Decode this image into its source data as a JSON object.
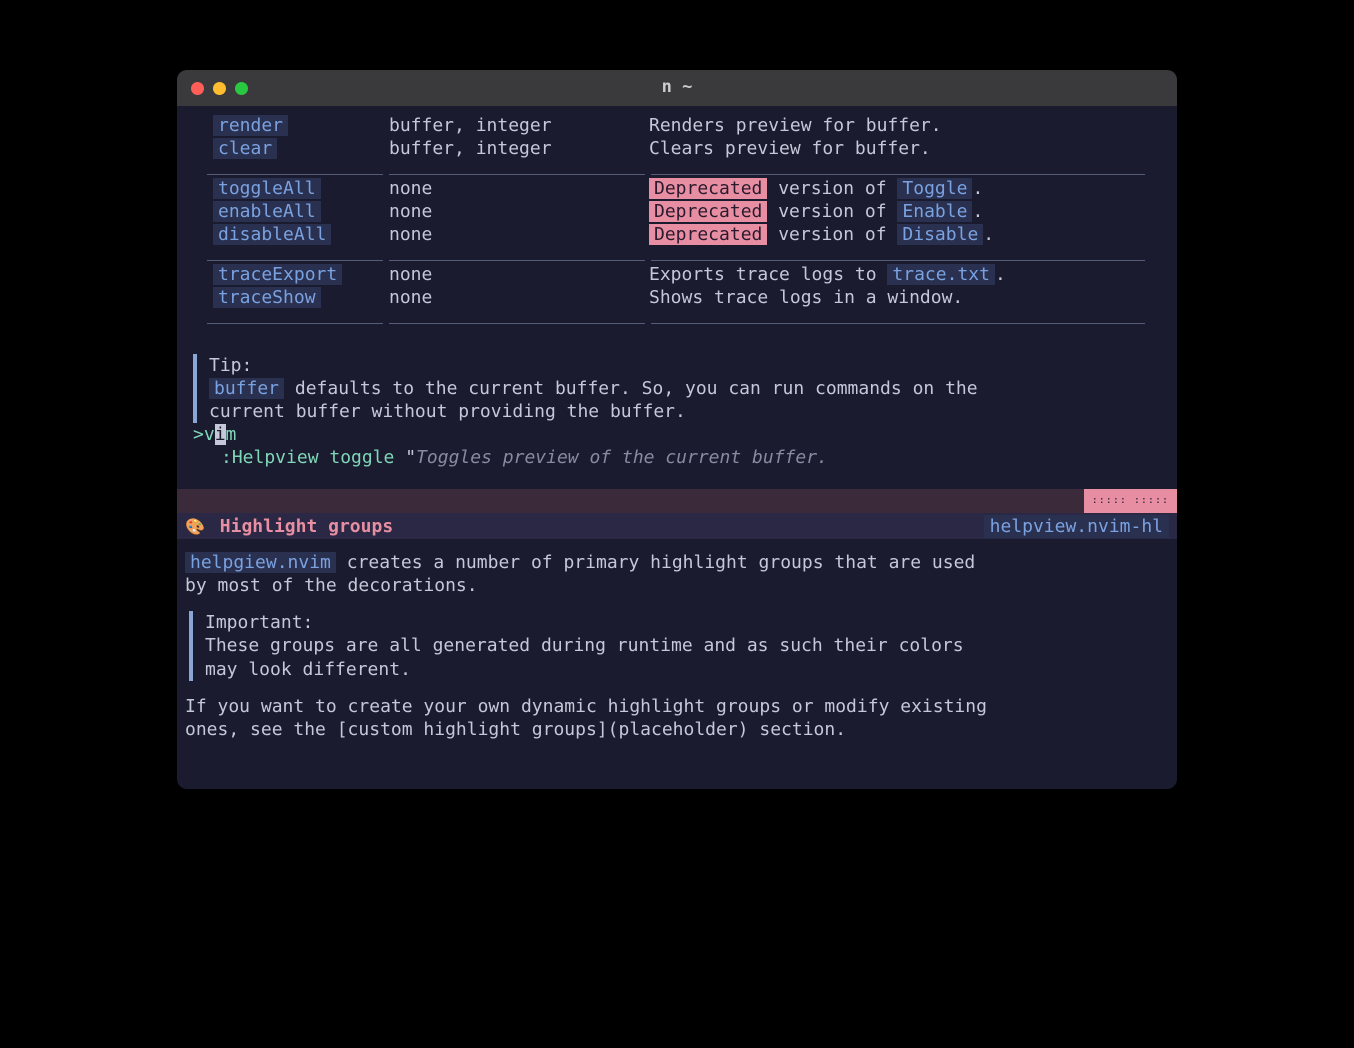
{
  "title": "n ~",
  "table": {
    "rows1": [
      {
        "cmd": "render",
        "args": "buffer, integer",
        "desc": "Renders preview for buffer."
      },
      {
        "cmd": "clear",
        "args": "buffer, integer",
        "desc": "Clears preview for buffer."
      }
    ],
    "rows2": [
      {
        "cmd": "toggleAll",
        "args": "none",
        "deprecated": "Deprecated",
        "desc_prefix": " version of ",
        "link": "Toggle",
        "desc_suffix": "."
      },
      {
        "cmd": "enableAll",
        "args": "none",
        "deprecated": "Deprecated",
        "desc_prefix": " version of ",
        "link": "Enable",
        "desc_suffix": "."
      },
      {
        "cmd": "disableAll",
        "args": "none",
        "deprecated": "Deprecated",
        "desc_prefix": " version of ",
        "link": "Disable",
        "desc_suffix": "."
      }
    ],
    "rows3": [
      {
        "cmd": "traceExport",
        "args": "none",
        "desc_prefix": "Exports trace logs to ",
        "link": "trace.txt",
        "desc_suffix": "."
      },
      {
        "cmd": "traceShow",
        "args": "none",
        "desc": "Shows trace logs in a window."
      }
    ]
  },
  "tip": {
    "label": "Tip:",
    "code": "buffer",
    "text1": " defaults to the current buffer. So, you can run commands on the",
    "text2": "current buffer without providing the buffer."
  },
  "vim_prompt": {
    "prefix": ">v",
    "cursor": "i",
    "suffix": "m"
  },
  "helpview": {
    "cmd": ":Helpview toggle ",
    "quote": "\"",
    "comment": "Toggles preview of the current buffer."
  },
  "section": {
    "dots": "::::: :::::",
    "icon": "🎨",
    "title": "Highlight groups",
    "tag": "helpview.nvim-hl"
  },
  "body": {
    "code1": "helpgiew.nvim",
    "text1": " creates a number of primary highlight groups that are used",
    "text2": "by most of the decorations.",
    "important_label": "Important:",
    "important_text1": "These groups are all generated during runtime and as such their colors",
    "important_text2": "may look different.",
    "text3": "If you want to create your own dynamic highlight groups or modify existing",
    "text4": "ones, see the [custom highlight groups](placeholder) section."
  }
}
